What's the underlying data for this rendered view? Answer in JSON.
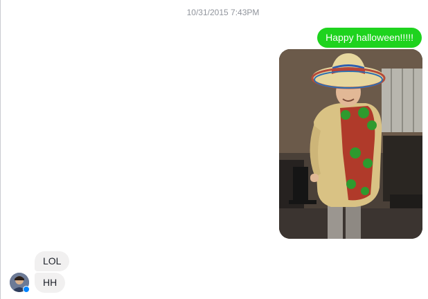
{
  "conversation": {
    "timestamp": "10/31/2015 7:43PM",
    "outgoing": {
      "text": "Happy halloween!!!!!",
      "bubble_color": "#1ed31e",
      "photo": {
        "type": "image",
        "subject": "person in sombrero and taco costume"
      }
    },
    "incoming": [
      {
        "text": "LOL"
      },
      {
        "text": "HH"
      }
    ],
    "incoming_bubble_color": "#f1f0f0",
    "sender_avatar": {
      "icon": "avatar-icon",
      "badge": "messenger-badge-icon",
      "badge_color": "#0084ff"
    }
  }
}
